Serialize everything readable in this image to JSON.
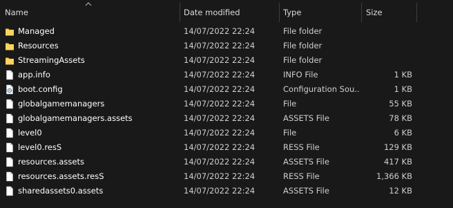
{
  "columns": {
    "name": "Name",
    "date": "Date modified",
    "type": "Type",
    "size": "Size"
  },
  "rows": [
    {
      "icon": "folder-icon",
      "name": "Managed",
      "date": "14/07/2022 22:24",
      "type": "File folder",
      "size": ""
    },
    {
      "icon": "folder-icon",
      "name": "Resources",
      "date": "14/07/2022 22:24",
      "type": "File folder",
      "size": ""
    },
    {
      "icon": "folder-icon",
      "name": "StreamingAssets",
      "date": "14/07/2022 22:24",
      "type": "File folder",
      "size": ""
    },
    {
      "icon": "file-icon",
      "name": "app.info",
      "date": "14/07/2022 22:24",
      "type": "INFO File",
      "size": "1 KB"
    },
    {
      "icon": "config-file-icon",
      "name": "boot.config",
      "date": "14/07/2022 22:24",
      "type": "Configuration Sou...",
      "size": "1 KB"
    },
    {
      "icon": "file-icon",
      "name": "globalgamemanagers",
      "date": "14/07/2022 22:24",
      "type": "File",
      "size": "55 KB"
    },
    {
      "icon": "file-icon",
      "name": "globalgamemanagers.assets",
      "date": "14/07/2022 22:24",
      "type": "ASSETS File",
      "size": "78 KB"
    },
    {
      "icon": "file-icon",
      "name": "level0",
      "date": "14/07/2022 22:24",
      "type": "File",
      "size": "6 KB"
    },
    {
      "icon": "file-icon",
      "name": "level0.resS",
      "date": "14/07/2022 22:24",
      "type": "RESS File",
      "size": "129 KB"
    },
    {
      "icon": "file-icon",
      "name": "resources.assets",
      "date": "14/07/2022 22:24",
      "type": "ASSETS File",
      "size": "417 KB"
    },
    {
      "icon": "file-icon",
      "name": "resources.assets.resS",
      "date": "14/07/2022 22:24",
      "type": "RESS File",
      "size": "1,366 KB"
    },
    {
      "icon": "file-icon",
      "name": "sharedassets0.assets",
      "date": "14/07/2022 22:24",
      "type": "ASSETS File",
      "size": "12 KB"
    }
  ],
  "colors": {
    "background": "#191919",
    "folder": "#f7c948",
    "text": "#ffffff",
    "secondary_text": "#cfcfcf"
  }
}
